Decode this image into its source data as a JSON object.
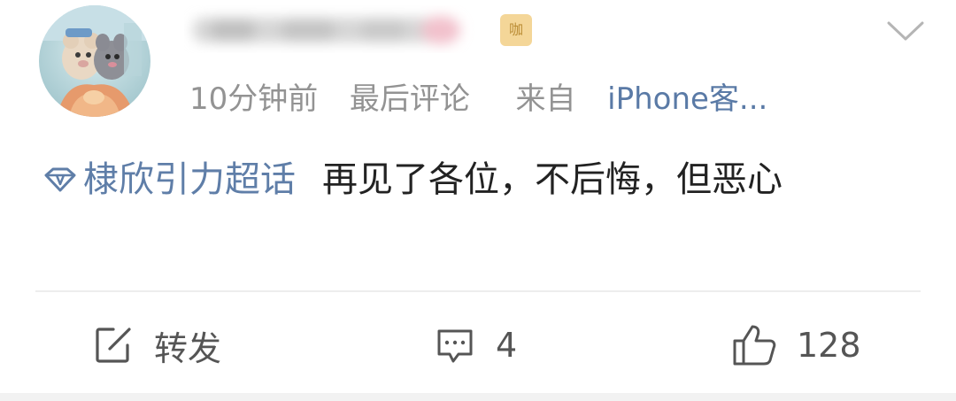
{
  "post": {
    "username": "",
    "vip_badge": "咖",
    "time": "10分钟前",
    "last_comment": "最后评论",
    "source_prefix": "来自",
    "source_name": "iPhone客...",
    "topic": "棣欣引力超话",
    "text": "再见了各位，不后悔，但恶心"
  },
  "actions": {
    "repost_label": "转发",
    "comment_count": "4",
    "like_count": "128"
  },
  "icons": {
    "topic": "diamond-icon",
    "collapse": "chevron-down-icon",
    "repost": "share-edit-icon",
    "comment": "comment-bubble-icon",
    "like": "thumbs-up-icon"
  },
  "colors": {
    "link": "#5f7ea8",
    "meta": "#939393",
    "text": "#222222"
  }
}
